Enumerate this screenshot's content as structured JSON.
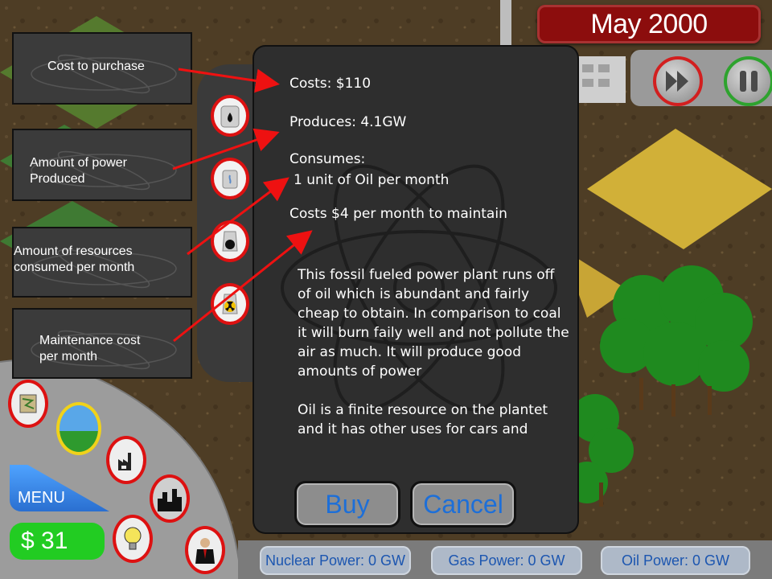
{
  "header": {
    "date": "May 2000"
  },
  "controls": {
    "play_icon": "play-icon",
    "pause_icon": "pause-icon"
  },
  "build_menu": {
    "items": [
      {
        "icon": "oil-plant-icon"
      },
      {
        "icon": "gas-plant-icon"
      },
      {
        "icon": "coal-plant-icon"
      },
      {
        "icon": "nuclear-plant-icon"
      }
    ]
  },
  "dialog": {
    "cost": "Costs: $110",
    "produces": "Produces: 4.1GW",
    "consumes_label": "Consumes:",
    "consumes_value": "1 unit of Oil per month",
    "maintenance": "Costs $4 per month to maintain",
    "description_1": "This fossil fueled power plant runs off of oil which is abundant and fairly cheap to obtain. In comparison to coal it will burn faily well and not pollute the air as much. It will produce good amounts of power",
    "description_2": "Oil is a finite resource on the plantet and it has other uses for cars and",
    "buy_label": "Buy",
    "cancel_label": "Cancel"
  },
  "callouts": {
    "cost": "Cost to purchase",
    "power_1": "Amount of power",
    "power_2": "Produced",
    "resources_1": "Amount of resources",
    "resources_2": "consumed per month",
    "maintenance_1": "Maintenance cost",
    "maintenance_2": "per month"
  },
  "sidebar": {
    "menu_label": "MENU",
    "money": "$ 31",
    "icons": [
      "map-icon",
      "landscape-icon",
      "factory-icon",
      "city-icon",
      "lightbulb-icon",
      "advisor-icon"
    ]
  },
  "status_bar": {
    "nuclear": "Nuclear Power: 0 GW",
    "gas": "Gas Power: 0 GW",
    "oil": "Oil Power: 0 GW"
  },
  "colors": {
    "date_bg": "#8c0d0d",
    "accent_red": "#d11111",
    "money_green": "#22cc22",
    "button_text_blue": "#1d6fd8"
  }
}
